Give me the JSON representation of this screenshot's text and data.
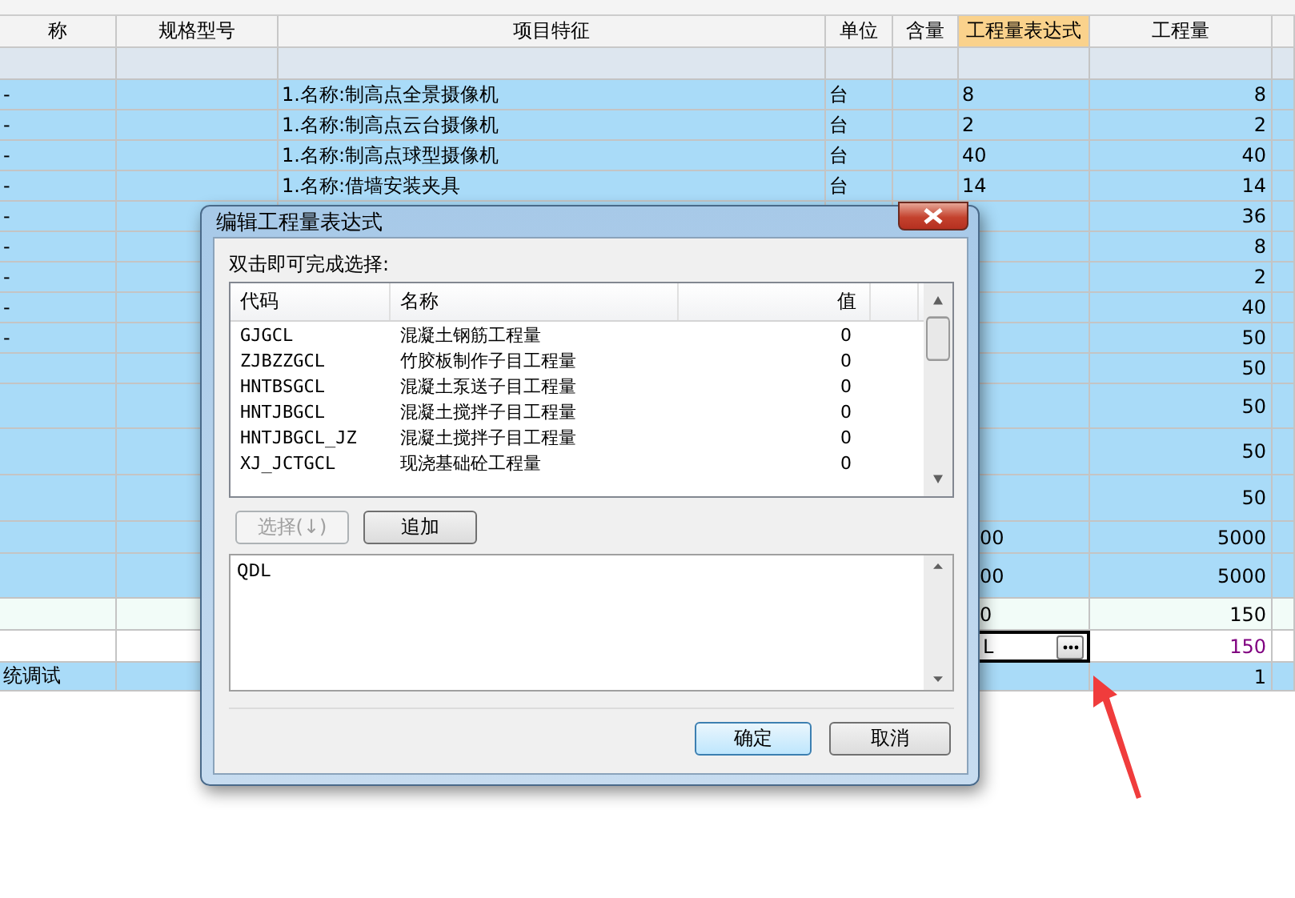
{
  "columns": [
    {
      "label": "称",
      "selected": false
    },
    {
      "label": "规格型号",
      "selected": false
    },
    {
      "label": "项目特征",
      "selected": false
    },
    {
      "label": "单位",
      "selected": false
    },
    {
      "label": "含量",
      "selected": false
    },
    {
      "label": "工程量表达式",
      "selected": true
    },
    {
      "label": "工程量",
      "selected": false
    }
  ],
  "rows": [
    {
      "kind": "group"
    },
    {
      "kind": "item",
      "selected": true,
      "name": "-",
      "feature": "1.名称:制高点全景摄像机",
      "unit": "台",
      "expression": "8",
      "quantity": "8"
    },
    {
      "kind": "item",
      "selected": true,
      "name": "-",
      "feature": "1.名称:制高点云台摄像机",
      "unit": "台",
      "expression": "2",
      "quantity": "2"
    },
    {
      "kind": "item",
      "selected": true,
      "name": "-",
      "feature": "1.名称:制高点球型摄像机",
      "unit": "台",
      "expression": "40",
      "quantity": "40"
    },
    {
      "kind": "item",
      "selected": true,
      "name": "-",
      "feature": "1.名称:借墙安装夹具",
      "unit": "台",
      "expression": "14",
      "quantity": "14"
    },
    {
      "kind": "item",
      "selected": true,
      "name": "-",
      "quantity": "36"
    },
    {
      "kind": "item",
      "selected": true,
      "name": "-",
      "quantity": "8"
    },
    {
      "kind": "item",
      "selected": true,
      "name": "-",
      "quantity": "2"
    },
    {
      "kind": "item",
      "selected": true,
      "name": "-",
      "quantity": "40"
    },
    {
      "kind": "item",
      "selected": true,
      "name": "-",
      "quantity": "50"
    },
    {
      "kind": "item",
      "selected": true,
      "quantity": "50"
    },
    {
      "kind": "item",
      "selected": true,
      "quantity": "50"
    },
    {
      "kind": "item",
      "selected": true,
      "quantity": "50"
    },
    {
      "kind": "item",
      "selected": true,
      "quantity": "50"
    },
    {
      "kind": "item",
      "selected": true,
      "expression": "00",
      "quantity": "5000"
    },
    {
      "kind": "item",
      "selected": true,
      "expression": "00",
      "quantity": "5000"
    },
    {
      "kind": "subtotal",
      "expression": "0",
      "quantity": "150"
    },
    {
      "kind": "editing",
      "selected": false,
      "expression": "L",
      "quantity": "150"
    },
    {
      "kind": "item",
      "selected": true,
      "name": "统调试",
      "quantity": "1"
    }
  ],
  "dialog": {
    "title": "编辑工程量表达式",
    "hint": "双击即可完成选择:",
    "list_columns": [
      "代码",
      "名称",
      "值"
    ],
    "list_rows": [
      {
        "code": "GJGCL",
        "name": "混凝土钢筋工程量",
        "value": "0"
      },
      {
        "code": "ZJBZZGCL",
        "name": "竹胶板制作子目工程量",
        "value": "0"
      },
      {
        "code": "HNTBSGCL",
        "name": "混凝土泵送子目工程量",
        "value": "0"
      },
      {
        "code": "HNTJBGCL",
        "name": "混凝土搅拌子目工程量",
        "value": "0"
      },
      {
        "code": "HNTJBGCL_JZ",
        "name": "混凝土搅拌子目工程量",
        "value": "0"
      },
      {
        "code": "XJ_JCTGCL",
        "name": "现浇基础砼工程量",
        "value": "0"
      }
    ],
    "select_button": {
      "label": "选择(↓)",
      "disabled": true
    },
    "add_button": {
      "label": "追加",
      "disabled": false
    },
    "expression": "QDL",
    "ok_button": "确定",
    "cancel_button": "取消"
  }
}
